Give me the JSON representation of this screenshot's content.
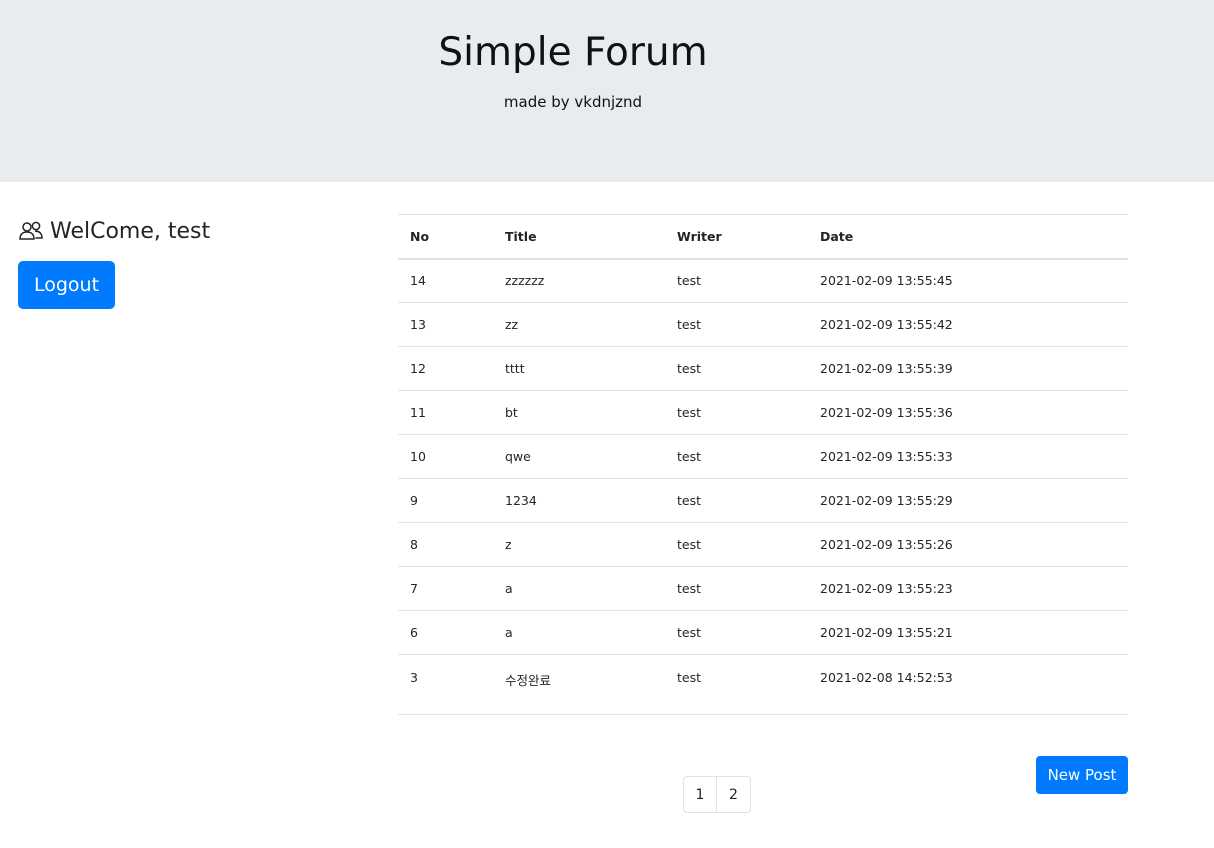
{
  "header": {
    "title": "Simple Forum",
    "subtitle": "made by vkdnjznd",
    "background_color": "#e9ecef"
  },
  "sidebar": {
    "welcome_text": "WelCome, test",
    "welcome_icon": "people-icon",
    "logout_label": "Logout"
  },
  "board": {
    "columns": [
      "No",
      "Title",
      "Writer",
      "Date"
    ],
    "rows": [
      {
        "no": "14",
        "title": "zzzzzz",
        "writer": "test",
        "date": "2021-02-09 13:55:45"
      },
      {
        "no": "13",
        "title": "zz",
        "writer": "test",
        "date": "2021-02-09 13:55:42"
      },
      {
        "no": "12",
        "title": "tttt",
        "writer": "test",
        "date": "2021-02-09 13:55:39"
      },
      {
        "no": "11",
        "title": "bt",
        "writer": "test",
        "date": "2021-02-09 13:55:36"
      },
      {
        "no": "10",
        "title": "qwe",
        "writer": "test",
        "date": "2021-02-09 13:55:33"
      },
      {
        "no": "9",
        "title": "1234",
        "writer": "test",
        "date": "2021-02-09 13:55:29"
      },
      {
        "no": "8",
        "title": "z",
        "writer": "test",
        "date": "2021-02-09 13:55:26"
      },
      {
        "no": "7",
        "title": "a",
        "writer": "test",
        "date": "2021-02-09 13:55:23"
      },
      {
        "no": "6",
        "title": "a",
        "writer": "test",
        "date": "2021-02-09 13:55:21"
      },
      {
        "no": "3",
        "title": "수정완료",
        "writer": "test",
        "date": "2021-02-08 14:52:53"
      }
    ]
  },
  "actions": {
    "new_post_label": "New Post"
  },
  "pagination": {
    "pages": [
      "1",
      "2"
    ]
  },
  "colors": {
    "primary": "#007bff",
    "border": "#dee2e6"
  }
}
